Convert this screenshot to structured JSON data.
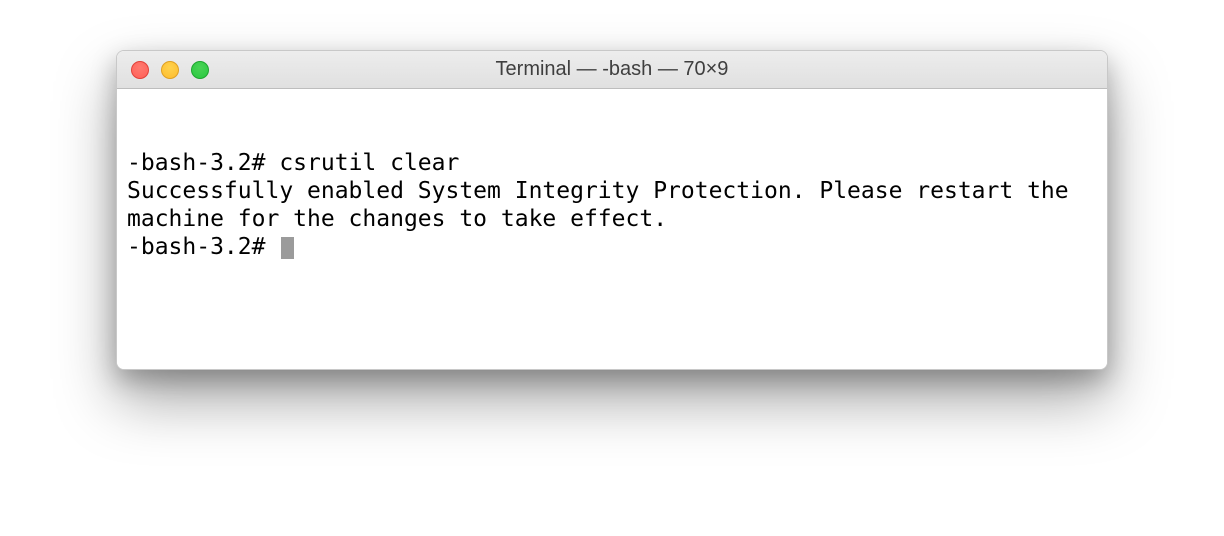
{
  "window": {
    "title": "Terminal — -bash — 70×9"
  },
  "terminal": {
    "line1_prompt": "-bash-3.2# ",
    "line1_command": "csrutil clear",
    "output": "Successfully enabled System Integrity Protection. Please restart the machine for the changes to take effect.",
    "line2_prompt": "-bash-3.2# "
  }
}
